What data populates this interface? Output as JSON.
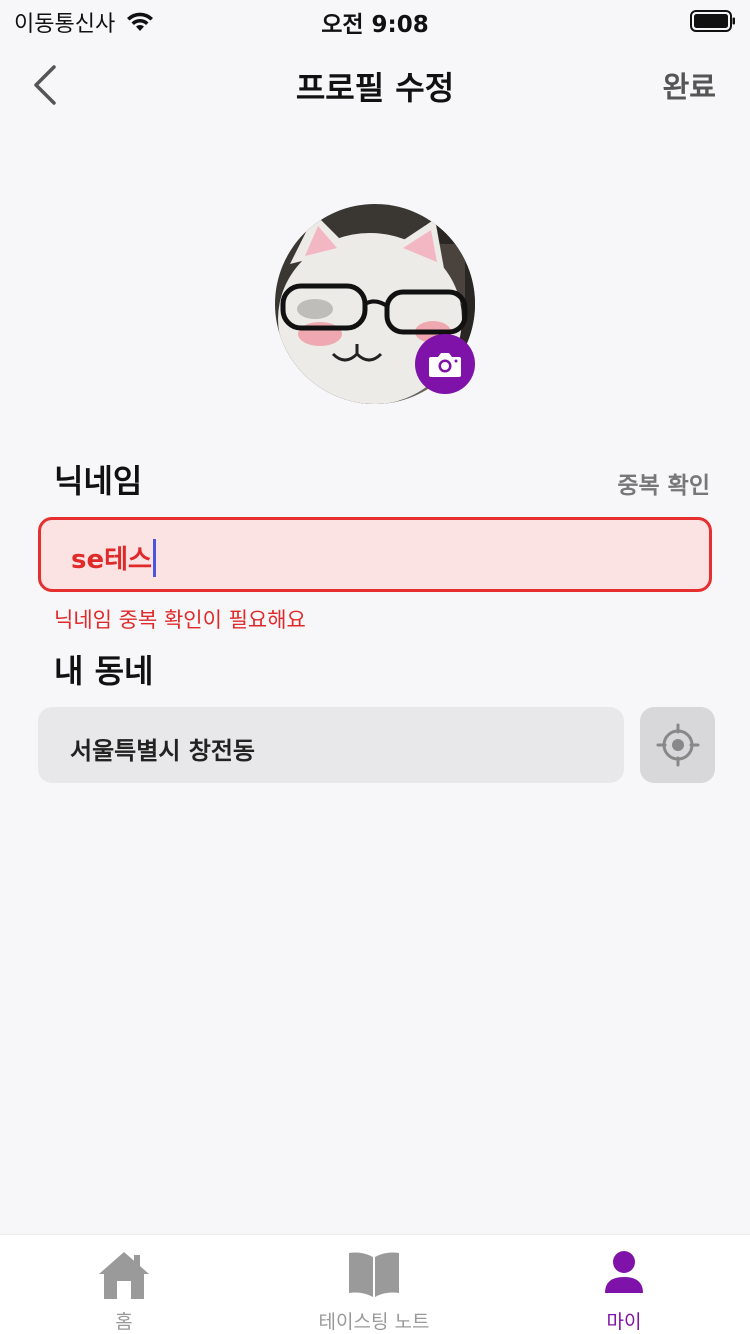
{
  "status_bar": {
    "carrier": "이동통신사",
    "time": "오전 9:08",
    "wifi_icon": "wifi-icon",
    "battery_icon": "battery-icon"
  },
  "nav": {
    "title": "프로필 수정",
    "done_label": "완료",
    "back_icon": "chevron-left-icon"
  },
  "profile": {
    "avatar": "profile-photo",
    "camera_icon": "camera-icon"
  },
  "nickname": {
    "label": "닉네임",
    "check_label": "중복 확인",
    "value": "se테스",
    "error": "닉네임 중복 확인이 필요해요"
  },
  "neighborhood": {
    "label": "내 동네",
    "value": "서울특별시 창전동",
    "locate_icon": "location-crosshair-icon"
  },
  "tabs": [
    {
      "label": "홈",
      "icon": "home-icon"
    },
    {
      "label": "테이스팅 노트",
      "icon": "book-icon"
    },
    {
      "label": "마이",
      "icon": "person-icon",
      "active": true
    }
  ],
  "colors": {
    "accent": "#7f12a8",
    "error": "#e02a2a",
    "error_bg": "#fbe3e4",
    "background": "#f7f7fa"
  }
}
